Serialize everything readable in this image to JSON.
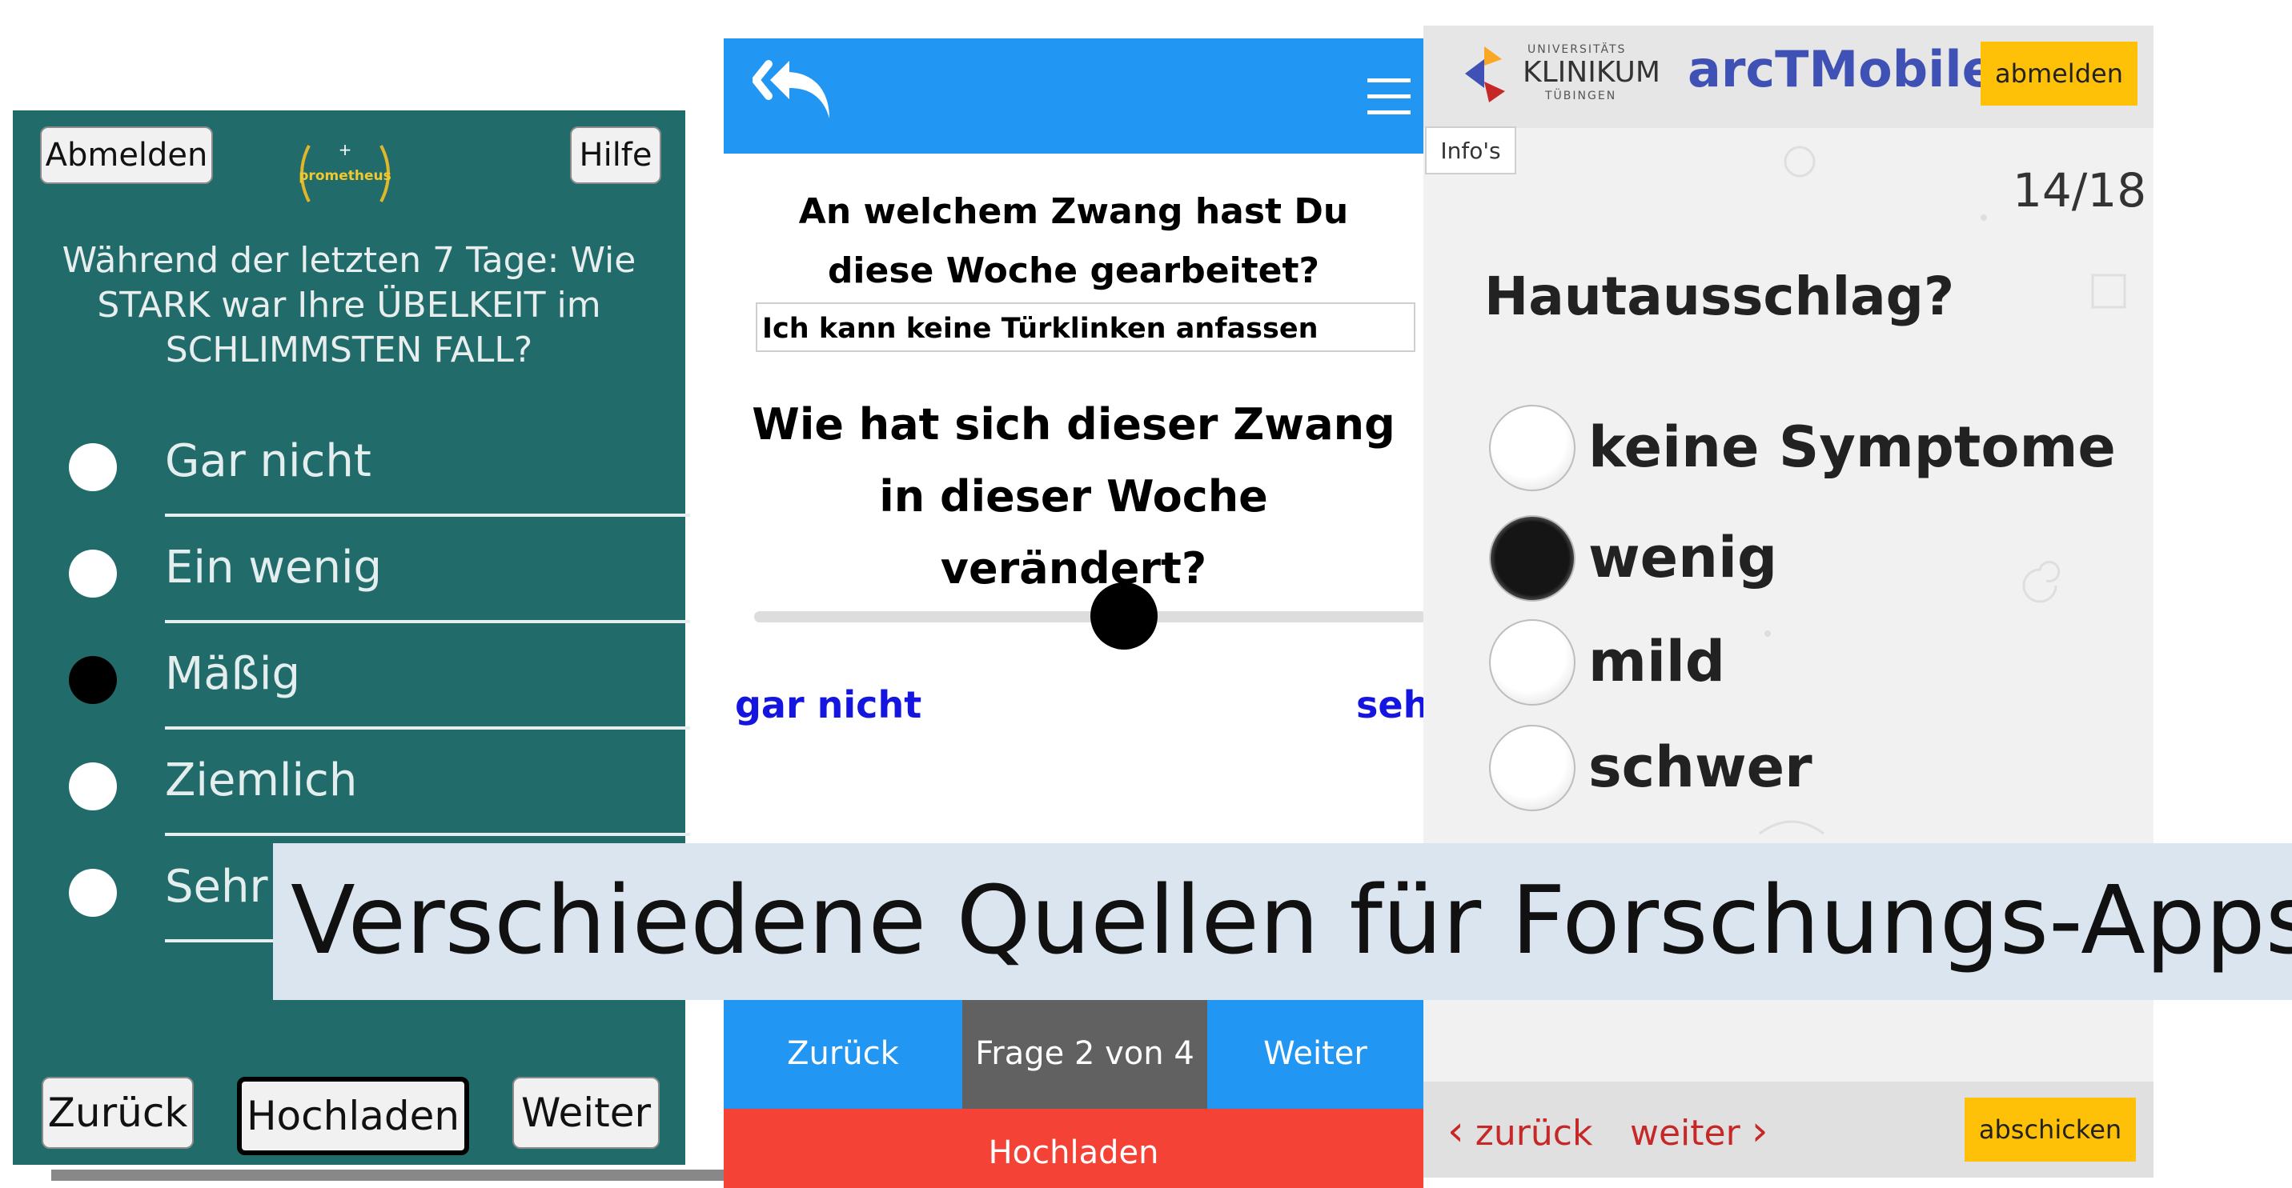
{
  "panel1": {
    "logout": "Abmelden",
    "help": "Hilfe",
    "logo_text": "prometheus",
    "question": "Während der letzten 7 Tage: Wie STARK war Ihre ÜBELKEIT im SCHLIMMSTEN FALL?",
    "options": [
      "Gar nicht",
      "Ein wenig",
      "Mäßig",
      "Ziemlich",
      "Sehr"
    ],
    "selected_option": "Mäßig",
    "back": "Zurück",
    "upload": "Hochladen",
    "next": "Weiter",
    "colors": {
      "background": "#226b6b"
    }
  },
  "panel2": {
    "question1": "An welchem Zwang hast Du diese Woche gearbeitet?",
    "answer": "Ich kann keine Türklinken anfassen",
    "question2": "Wie hat sich dieser Zwang in dieser Woche verändert?",
    "slider_low": "gar nicht",
    "slider_high": "sehr",
    "slider_value_fraction": 0.55,
    "back": "Zurück",
    "progress": "Frage 2 von 4",
    "next": "Weiter",
    "upload": "Hochladen",
    "icons": {
      "back": "reply-all-icon",
      "menu": "hamburger-menu-icon"
    },
    "colors": {
      "header": "#2196f3",
      "upload": "#f44336",
      "slider_labels": "#1515e0"
    }
  },
  "panel3": {
    "logo_line1": "UNIVERSITÄTS",
    "logo_line2": "KLINIKUM",
    "logo_line3": "TÜBINGEN",
    "app_title": "arcTMobile",
    "logout": "abmelden",
    "infos": "Info's",
    "counter": "14/18",
    "question": "Hautausschlag?",
    "options": [
      "keine Symptome",
      "wenig",
      "mild",
      "schwer"
    ],
    "selected_option": "wenig",
    "back": "zurück",
    "next": "weiter",
    "submit": "abschicken",
    "colors": {
      "title": "#3f51b5",
      "buttons": "#ffc107",
      "nav": "#c62828"
    }
  },
  "banner": {
    "text": "Verschiedene Quellen für Forschungs-Apps"
  }
}
